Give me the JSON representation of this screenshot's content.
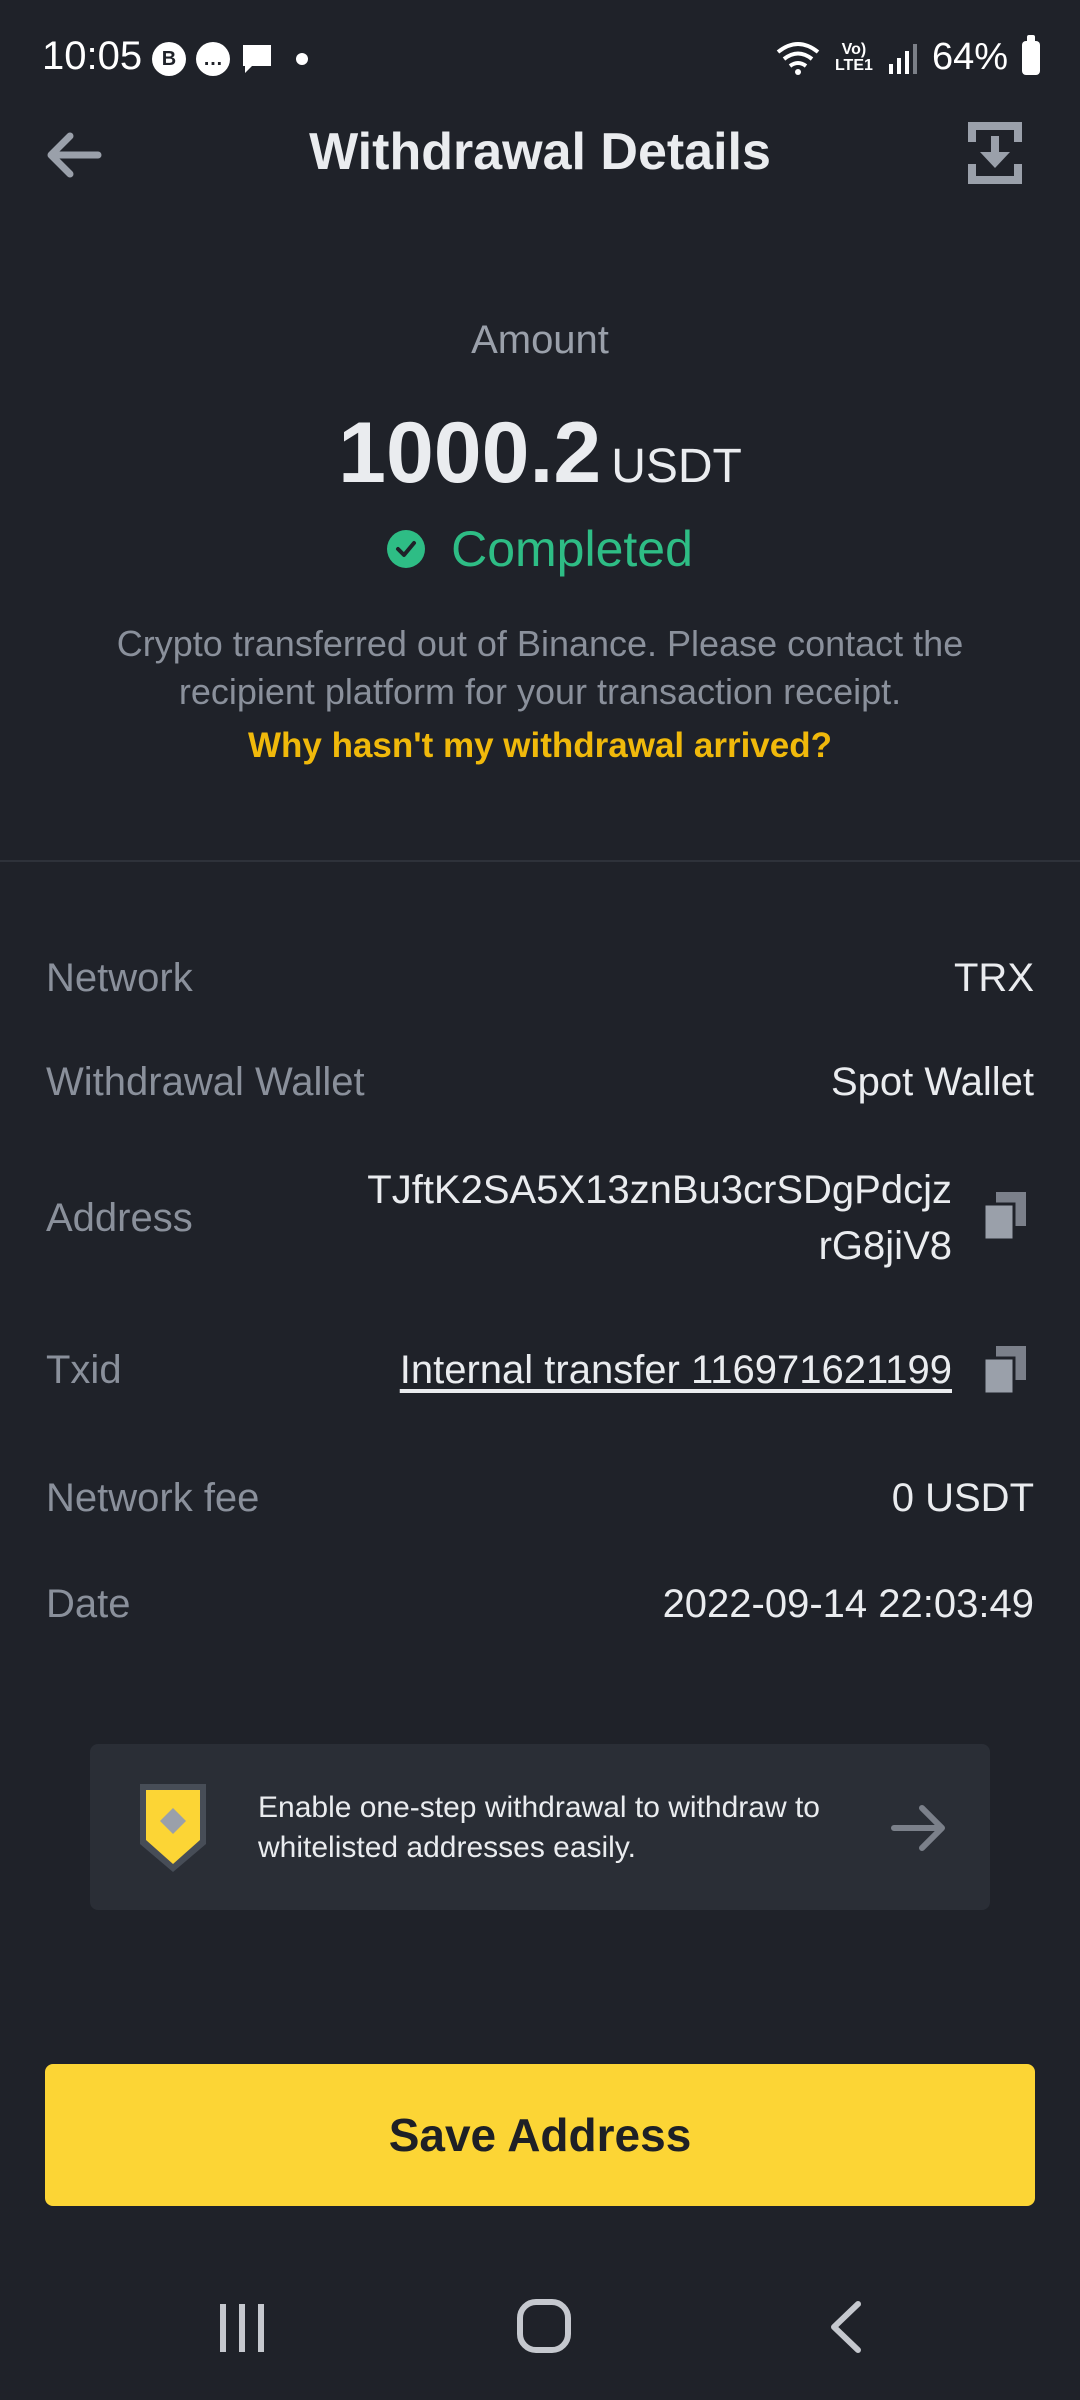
{
  "status_bar": {
    "time": "10:05",
    "notification_icons": [
      "B",
      "…",
      ""
    ],
    "lte_label": "Vo) LTE1",
    "battery": "64%"
  },
  "header": {
    "title": "Withdrawal Details"
  },
  "summary": {
    "amount_label": "Amount",
    "amount_value": "1000.2",
    "amount_unit": "USDT",
    "status": "Completed",
    "description": "Crypto transferred out of Binance. Please contact the recipient platform for your transaction receipt.",
    "help_link": "Why hasn't my withdrawal arrived?"
  },
  "details": {
    "network": {
      "label": "Network",
      "value": "TRX"
    },
    "wallet": {
      "label": "Withdrawal Wallet",
      "value": "Spot Wallet"
    },
    "address": {
      "label": "Address",
      "value_line1": "TJftK2SA5X13znBu3crSDgPdcjz",
      "value_line2": "rG8jiV8"
    },
    "txid": {
      "label": "Txid",
      "value": "Internal transfer 116971621199"
    },
    "fee": {
      "label": "Network fee",
      "value": "0 USDT"
    },
    "date": {
      "label": "Date",
      "value": "2022-09-14 22:03:49"
    }
  },
  "promo": {
    "text": "Enable one-step withdrawal to withdraw to whitelisted addresses easily."
  },
  "actions": {
    "save_label": "Save Address"
  },
  "colors": {
    "background": "#1f2229",
    "accent_yellow": "#fcd535",
    "link_yellow": "#f0b90b",
    "success_green": "#2ebd85",
    "muted_text": "#8a909b"
  },
  "icons": {
    "back": "back-arrow-icon",
    "download": "download-icon",
    "status": "check-circle-icon",
    "copy": "copy-icon",
    "promo": "shield-icon",
    "promo_arrow": "arrow-right-icon"
  }
}
